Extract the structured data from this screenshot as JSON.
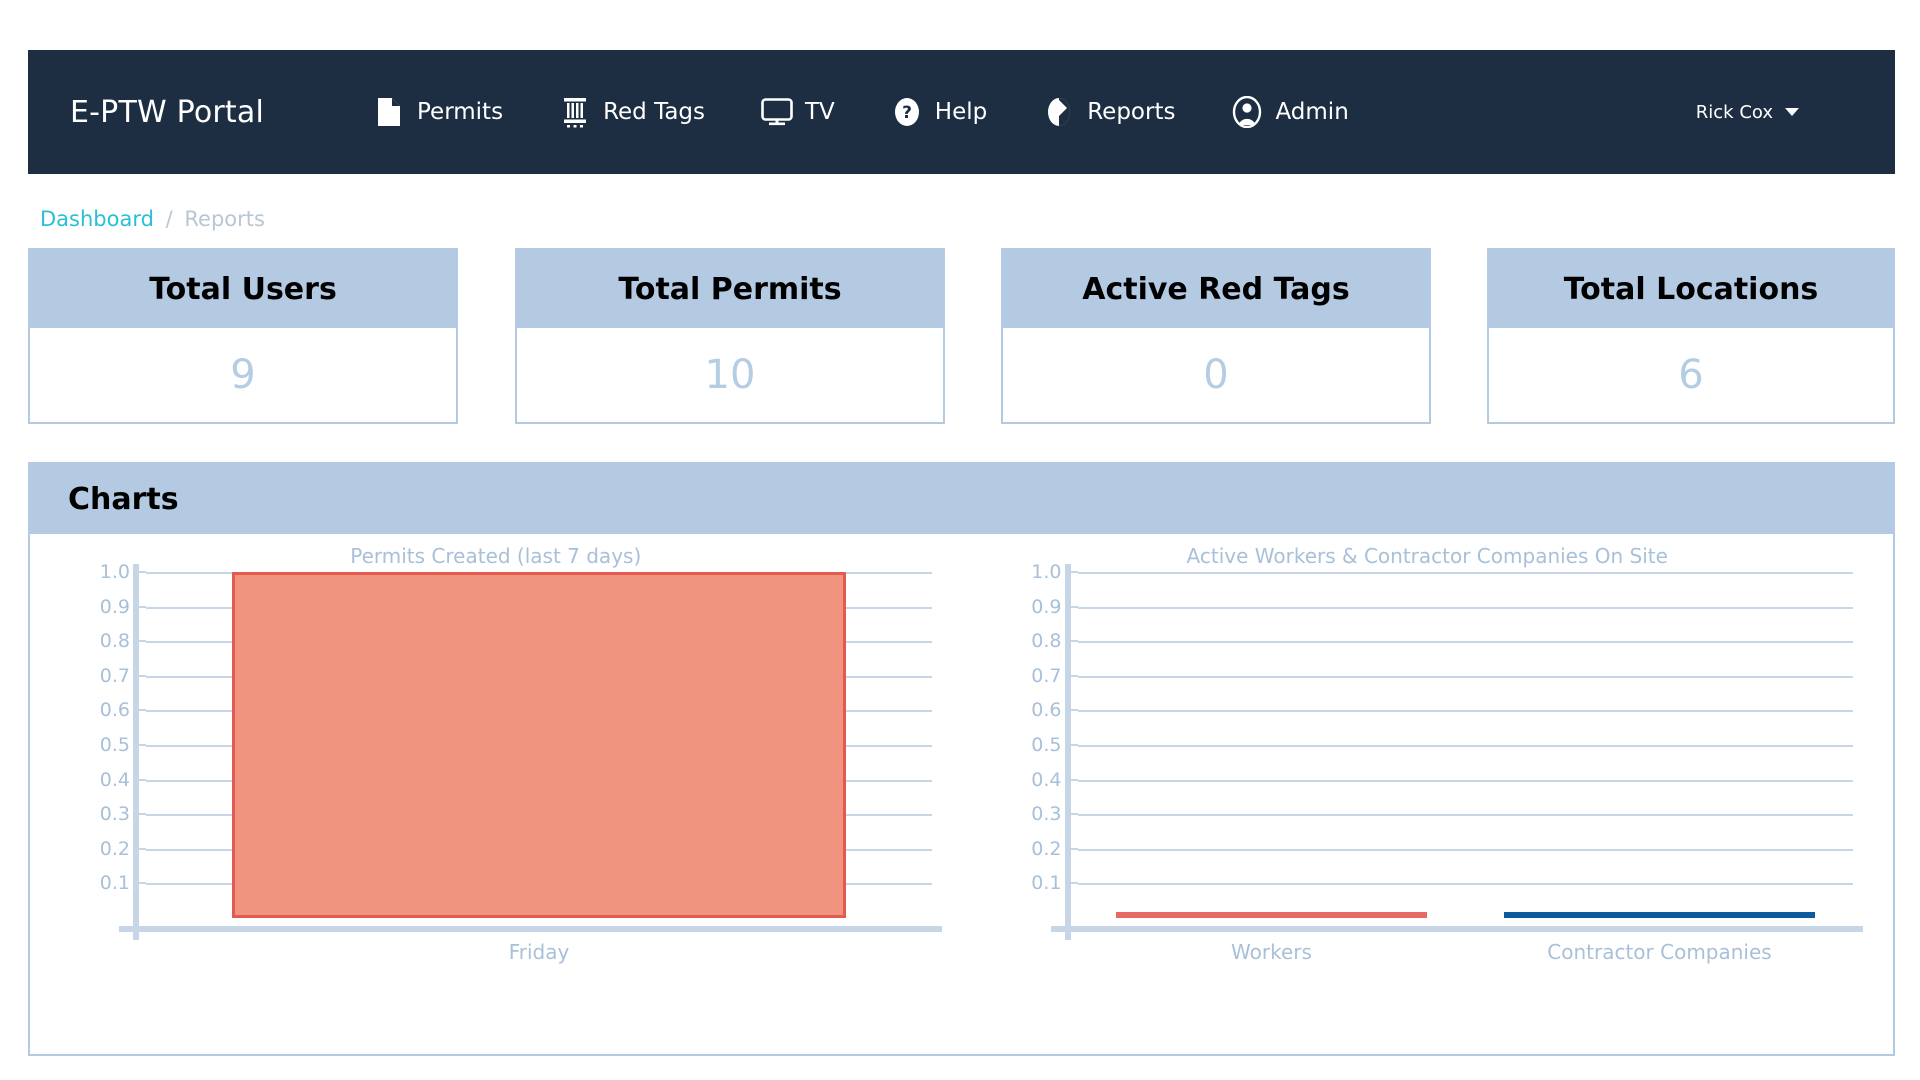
{
  "navbar": {
    "brand": "E-PTW Portal",
    "links": [
      {
        "label": "Permits",
        "icon": "document-icon"
      },
      {
        "label": "Red Tags",
        "icon": "column-icon"
      },
      {
        "label": "TV",
        "icon": "monitor-icon"
      },
      {
        "label": "Help",
        "icon": "question-circle-icon"
      },
      {
        "label": "Reports",
        "icon": "pie-chart-icon"
      },
      {
        "label": "Admin",
        "icon": "user-circle-icon"
      }
    ],
    "user": {
      "name": "Rick Cox",
      "caret": "chevron-down-icon"
    },
    "background_color": "#1d2d42"
  },
  "breadcrumb": {
    "root": "Dashboard",
    "separator": "/",
    "current": "Reports",
    "root_color": "#29c0d4",
    "current_color": "#b9c6d4"
  },
  "stat_cards": [
    {
      "title": "Total Users",
      "value": "9"
    },
    {
      "title": "Total Permits",
      "value": "10"
    },
    {
      "title": "Active Red Tags",
      "value": "0"
    },
    {
      "title": "Total Locations",
      "value": "6"
    }
  ],
  "charts_panel": {
    "title": "Charts",
    "header_color": "#b4cae2"
  },
  "chart_data": [
    {
      "type": "bar",
      "title": "Permits Created (last 7 days)",
      "categories": [
        "Friday"
      ],
      "values": [
        1.0
      ],
      "xlabel": "",
      "ylabel": "",
      "ylim": [
        0,
        1.0
      ],
      "yticks": [
        "1.0",
        "0.9",
        "0.8",
        "0.7",
        "0.6",
        "0.5",
        "0.4",
        "0.3",
        "0.2",
        "0.1"
      ],
      "grid": true,
      "legend": "none",
      "series": [
        {
          "name": "Friday",
          "values": [
            1.0
          ],
          "fill_color": "#f0937f",
          "border_color": "#e25b4e"
        }
      ]
    },
    {
      "type": "bar",
      "title": "Active Workers & Contractor Companies On Site",
      "categories": [
        "Workers",
        "Contractor Companies"
      ],
      "values": [
        0,
        0
      ],
      "xlabel": "",
      "ylabel": "",
      "ylim": [
        0,
        1.0
      ],
      "yticks": [
        "1.0",
        "0.9",
        "0.8",
        "0.7",
        "0.6",
        "0.5",
        "0.4",
        "0.3",
        "0.2",
        "0.1"
      ],
      "grid": true,
      "legend": "none",
      "series": [
        {
          "name": "Workers",
          "values": [
            0
          ],
          "fill_color": "#e56a63"
        },
        {
          "name": "Contractor Companies",
          "values": [
            0
          ],
          "fill_color": "#0d5a9e"
        }
      ]
    }
  ]
}
